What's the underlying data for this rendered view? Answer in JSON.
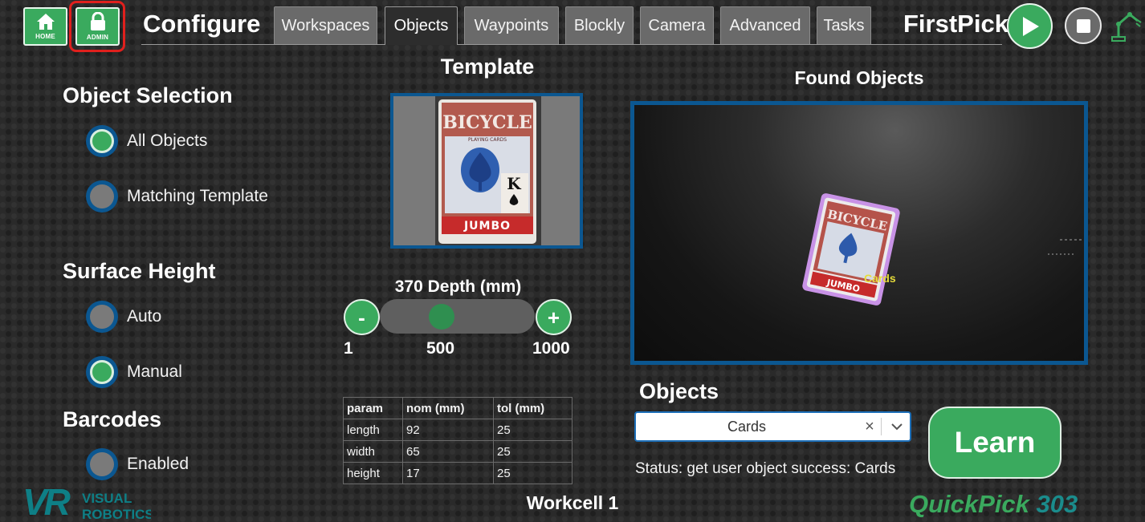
{
  "header": {
    "home_label": "HOME",
    "admin_label": "ADMIN",
    "title": "Configure",
    "tabs": [
      {
        "label": "Workspaces",
        "active": false
      },
      {
        "label": "Objects",
        "active": true
      },
      {
        "label": "Waypoints",
        "active": false
      },
      {
        "label": "Blockly",
        "active": false
      },
      {
        "label": "Camera",
        "active": false
      },
      {
        "label": "Advanced",
        "active": false
      },
      {
        "label": "Tasks",
        "active": false
      }
    ],
    "program_name": "FirstPick",
    "icons": {
      "home": "home-icon",
      "admin": "lock-icon",
      "play": "play-icon",
      "stop": "stop-icon",
      "robot": "robot-arm-icon"
    }
  },
  "object_selection": {
    "title": "Object Selection",
    "options": [
      {
        "label": "All Objects",
        "selected": true
      },
      {
        "label": "Matching Template",
        "selected": false
      }
    ]
  },
  "surface_height": {
    "title": "Surface Height",
    "options": [
      {
        "label": "Auto",
        "selected": false
      },
      {
        "label": "Manual",
        "selected": true
      }
    ]
  },
  "barcodes": {
    "title": "Barcodes",
    "options": [
      {
        "label": "Enabled",
        "selected": false
      }
    ]
  },
  "template": {
    "title": "Template",
    "card": {
      "brand": "BICYCLE",
      "size": "JUMBO",
      "subtitle": "PLAYING CARDS",
      "rank": "K"
    }
  },
  "depth": {
    "label": "370 Depth (mm)",
    "value": 370,
    "min": 1,
    "max": 1000,
    "min_label": "1",
    "mid_label": "500",
    "max_label": "1000",
    "minus_label": "-",
    "plus_label": "+"
  },
  "params": {
    "headers": [
      "param",
      "nom (mm)",
      "tol (mm)"
    ],
    "rows": [
      [
        "length",
        "92",
        "25"
      ],
      [
        "width",
        "65",
        "25"
      ],
      [
        "height",
        "17",
        "25"
      ]
    ]
  },
  "found_objects": {
    "title": "Found Objects",
    "detection_label": "Cards",
    "card": {
      "brand": "BICYCLE",
      "size": "JUMBO"
    }
  },
  "objects": {
    "title": "Objects",
    "selected": "Cards",
    "clear_label": "×"
  },
  "learn_label": "Learn",
  "status": "Status: get user object success: Cards",
  "footer": {
    "workcell": "Workcell 1",
    "logo_mark": "VR",
    "logo_line1": "VISUAL",
    "logo_line2": "ROBOTICS",
    "product_a": "QuickPick",
    "product_b": " 303"
  },
  "colors": {
    "accent_green": "#3aaa5e",
    "frame_blue": "#0b5791",
    "admin_highlight": "#e0201d",
    "background": "#2a2a2a"
  }
}
